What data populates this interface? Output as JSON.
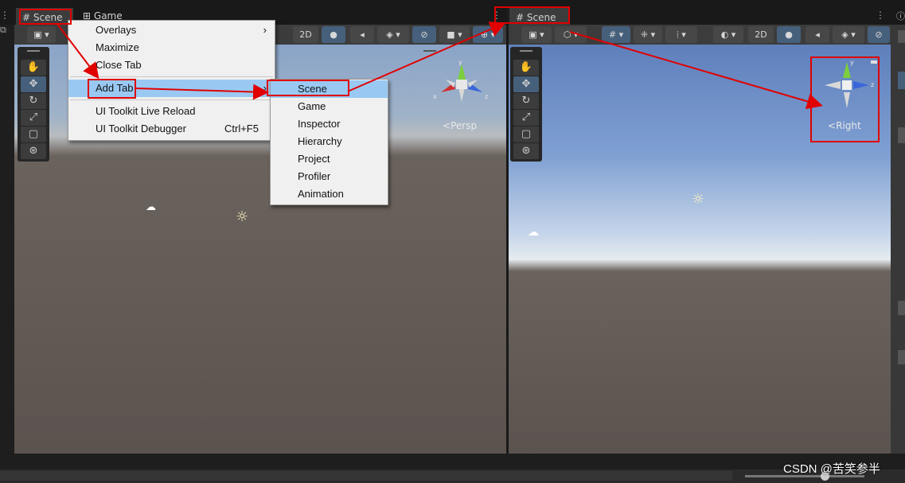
{
  "left_panel": {
    "tabs": [
      {
        "label": "Scene",
        "icon": "grid-icon"
      },
      {
        "label": "Game",
        "icon": "gamepad-icon"
      }
    ],
    "toolbar_2d_label": "2D",
    "gizmo_label": "Persp",
    "gizmo_axes": {
      "x": "x",
      "y": "y",
      "z": "z"
    }
  },
  "right_panel": {
    "tab": {
      "label": "Scene",
      "icon": "grid-icon"
    },
    "toolbar_2d_label": "2D",
    "gizmo_label": "Right",
    "gizmo_axes": {
      "y": "y",
      "z": "z"
    }
  },
  "context_menu": {
    "items": [
      {
        "label": "Overlays",
        "has_submenu": true
      },
      {
        "label": "Maximize"
      },
      {
        "label": "Close Tab"
      },
      {
        "label": "Add Tab",
        "has_submenu": true,
        "highlighted": true
      },
      {
        "label": "UI Toolkit Live Reload"
      },
      {
        "label": "UI Toolkit Debugger",
        "shortcut": "Ctrl+F5"
      }
    ],
    "submenu_arrow": "›"
  },
  "submenu": {
    "items": [
      "Scene",
      "Game",
      "Inspector",
      "Hierarchy",
      "Project",
      "Profiler",
      "Animation"
    ],
    "highlighted": "Scene"
  },
  "tools": [
    "hand-tool",
    "move-tool",
    "rotate-tool",
    "scale-tool",
    "rect-tool",
    "transform-tool"
  ],
  "watermark": "CSDN @苦笑参半",
  "colors": {
    "highlight": "#99c9f3",
    "annotation": "#e00000",
    "selected_tool": "#46607c"
  }
}
